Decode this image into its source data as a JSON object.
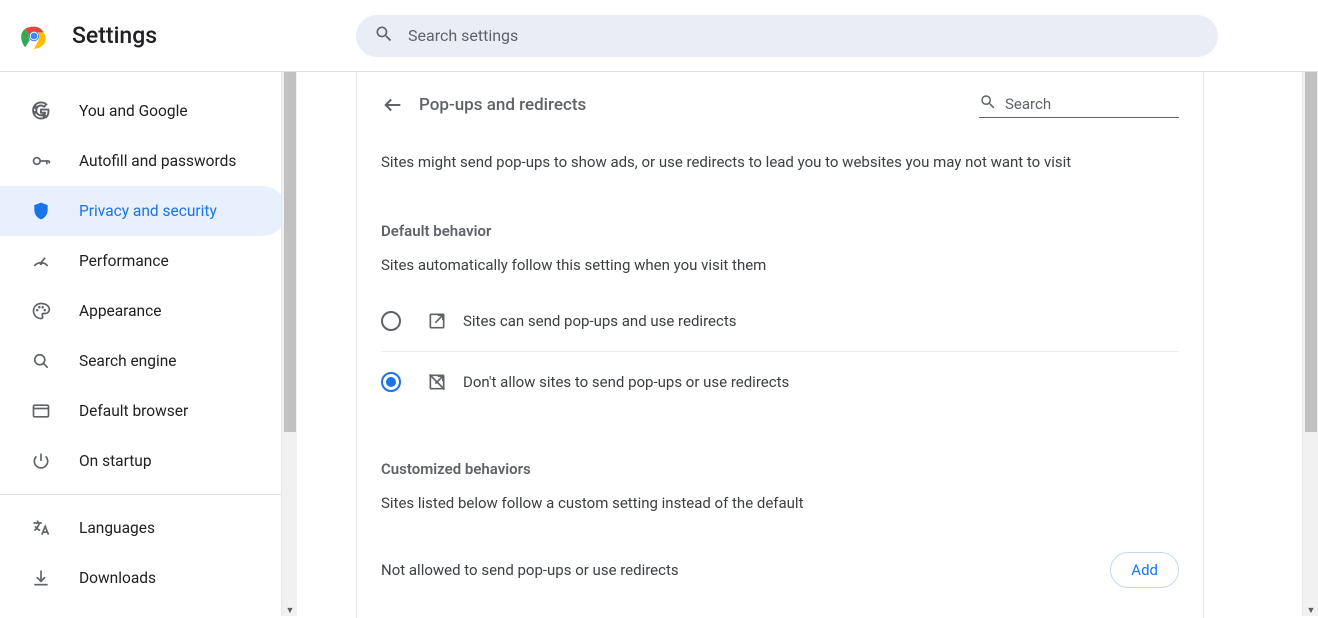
{
  "header": {
    "title": "Settings",
    "search_placeholder": "Search settings"
  },
  "sidebar": {
    "items": [
      {
        "label": "You and Google",
        "icon": "google"
      },
      {
        "label": "Autofill and passwords",
        "icon": "key"
      },
      {
        "label": "Privacy and security",
        "icon": "shield",
        "active": true
      },
      {
        "label": "Performance",
        "icon": "gauge"
      },
      {
        "label": "Appearance",
        "icon": "palette"
      },
      {
        "label": "Search engine",
        "icon": "search"
      },
      {
        "label": "Default browser",
        "icon": "browser"
      },
      {
        "label": "On startup",
        "icon": "power"
      }
    ],
    "items2": [
      {
        "label": "Languages",
        "icon": "translate"
      },
      {
        "label": "Downloads",
        "icon": "download"
      }
    ]
  },
  "panel": {
    "title": "Pop-ups and redirects",
    "search_placeholder": "Search",
    "description": "Sites might send pop-ups to show ads, or use redirects to lead you to websites you may not want to visit",
    "default_section_label": "Default behavior",
    "default_section_sub": "Sites automatically follow this setting when you visit them",
    "options": [
      {
        "label": "Sites can send pop-ups and use redirects",
        "checked": false,
        "icon": "open"
      },
      {
        "label": "Don't allow sites to send pop-ups or use redirects",
        "checked": true,
        "icon": "open-blocked"
      }
    ],
    "custom_section_label": "Customized behaviors",
    "custom_section_sub": "Sites listed below follow a custom setting instead of the default",
    "blocked_list_label": "Not allowed to send pop-ups or use redirects",
    "add_button": "Add"
  }
}
